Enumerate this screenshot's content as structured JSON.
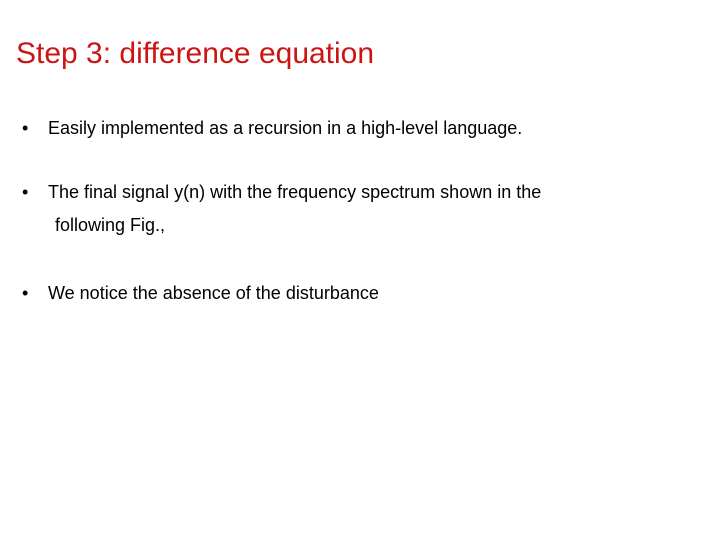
{
  "slide": {
    "title": "Step 3: difference equation",
    "title_color": "#cc1414",
    "background_color": "#ffffff",
    "text_color": "#000000",
    "bullet_marker": "•",
    "bullets": [
      {
        "lines": [
          "Easily implemented as a recursion in a high-level language."
        ]
      },
      {
        "lines": [
          "The final signal y(n) with the frequency spectrum shown in the",
          "following Fig.,"
        ]
      },
      {
        "lines": [
          "We notice the absence of the disturbance"
        ]
      }
    ]
  }
}
